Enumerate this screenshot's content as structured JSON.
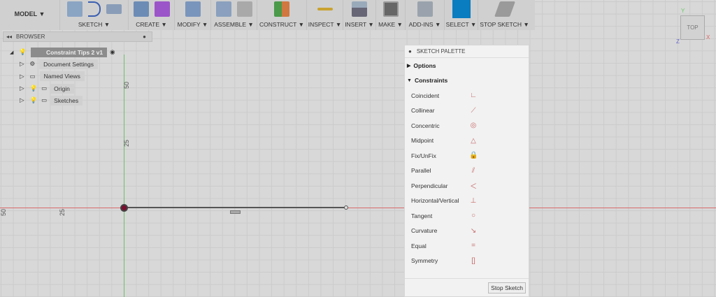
{
  "toolbar": {
    "model": "MODEL ▼",
    "groups": [
      "SKETCH ▼",
      "CREATE ▼",
      "MODIFY ▼",
      "ASSEMBLE ▼",
      "CONSTRUCT ▼",
      "INSPECT ▼",
      "INSERT ▼",
      "MAKE ▼",
      "ADD-INS ▼",
      "SELECT ▼",
      "STOP SKETCH ▼"
    ]
  },
  "browser": {
    "title": "BROWSER",
    "root": "Constraint Tips 2 v1",
    "items": [
      "Document Settings",
      "Named Views",
      "Origin",
      "Sketches"
    ]
  },
  "canvas": {
    "labels": [
      "50",
      "25",
      "50",
      "25"
    ],
    "viewcube": {
      "face": "TOP",
      "x": "X",
      "y": "Y",
      "z": "Z"
    }
  },
  "palette": {
    "title": "SKETCH PALETTE",
    "options": "Options",
    "constraints": "Constraints",
    "items": [
      {
        "label": "Coincident",
        "icon": "∟"
      },
      {
        "label": "Collinear",
        "icon": "⟋"
      },
      {
        "label": "Concentric",
        "icon": "◎"
      },
      {
        "label": "Midpoint",
        "icon": "△"
      },
      {
        "label": "Fix/UnFix",
        "icon": "🔒"
      },
      {
        "label": "Parallel",
        "icon": "⫽"
      },
      {
        "label": "Perpendicular",
        "icon": "＜"
      },
      {
        "label": "Horizontal/Vertical",
        "icon": "⊥"
      },
      {
        "label": "Tangent",
        "icon": "○"
      },
      {
        "label": "Curvature",
        "icon": "↘"
      },
      {
        "label": "Equal",
        "icon": "="
      },
      {
        "label": "Symmetry",
        "icon": "[]"
      }
    ],
    "stop": "Stop Sketch"
  },
  "colors": {
    "select": "#0a7cc0",
    "xaxis": "#d04040",
    "yaxis": "#50b050"
  }
}
